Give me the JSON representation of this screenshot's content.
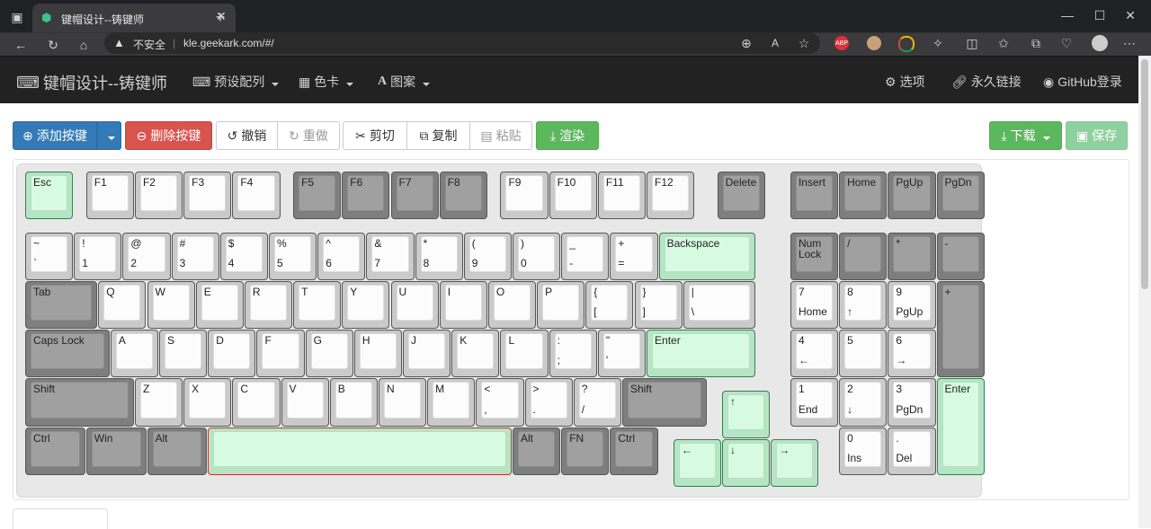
{
  "browser": {
    "tab_title": "键帽设计--铸键师",
    "security_label": "不安全",
    "url": "kle.geekark.com/#/"
  },
  "navbar": {
    "brand": "键帽设计--铸键师",
    "menus": [
      "预设配列",
      "色卡",
      "图案"
    ],
    "right": [
      "选项",
      "永久链接",
      "GitHub登录"
    ]
  },
  "toolbar": {
    "add_key": "添加按键",
    "delete_key": "删除按键",
    "undo": "撤销",
    "redo": "重做",
    "cut": "剪切",
    "copy": "复制",
    "paste": "粘贴",
    "render": "渲染",
    "download": "下载",
    "save": "保存"
  },
  "colors": {
    "key_white": "#fcfcfc",
    "key_gray": "#a0a0a0",
    "key_green": "#d6fbe1",
    "brand_primary": "#337ab7",
    "danger": "#d9534f",
    "success": "#5cb85c"
  },
  "keys": [
    {
      "top": "Esc",
      "c": "green"
    },
    {
      "top": "F1",
      "c": "white"
    },
    {
      "top": "F2",
      "c": "white"
    },
    {
      "top": "F3",
      "c": "white"
    },
    {
      "top": "F4",
      "c": "white"
    },
    {
      "top": "F5",
      "c": "gray"
    },
    {
      "top": "F6",
      "c": "gray"
    },
    {
      "top": "F7",
      "c": "gray"
    },
    {
      "top": "F8",
      "c": "gray"
    },
    {
      "top": "F9",
      "c": "white"
    },
    {
      "top": "F10",
      "c": "white"
    },
    {
      "top": "F11",
      "c": "white"
    },
    {
      "top": "F12",
      "c": "white"
    },
    {
      "top": "Delete",
      "c": "gray"
    },
    {
      "top": "Insert",
      "c": "gray"
    },
    {
      "top": "Home",
      "c": "gray"
    },
    {
      "top": "PgUp",
      "c": "gray"
    },
    {
      "top": "PgDn",
      "c": "gray"
    },
    {
      "top": "~",
      "bot": "`",
      "c": "white"
    },
    {
      "top": "!",
      "bot": "1",
      "c": "white"
    },
    {
      "top": "@",
      "bot": "2",
      "c": "white"
    },
    {
      "top": "#",
      "bot": "3",
      "c": "white"
    },
    {
      "top": "$",
      "bot": "4",
      "c": "white"
    },
    {
      "top": "%",
      "bot": "5",
      "c": "white"
    },
    {
      "top": "^",
      "bot": "6",
      "c": "white"
    },
    {
      "top": "&",
      "bot": "7",
      "c": "white"
    },
    {
      "top": "*",
      "bot": "8",
      "c": "white"
    },
    {
      "top": "(",
      "bot": "9",
      "c": "white"
    },
    {
      "top": ")",
      "bot": "0",
      "c": "white"
    },
    {
      "top": "_",
      "bot": "-",
      "c": "white"
    },
    {
      "top": "+",
      "bot": "=",
      "c": "white"
    },
    {
      "top": "Backspace",
      "c": "green"
    },
    {
      "top": "Num\nLock",
      "c": "gray"
    },
    {
      "top": "/",
      "c": "gray"
    },
    {
      "top": "*",
      "c": "gray"
    },
    {
      "top": "-",
      "c": "gray"
    },
    {
      "top": "Tab",
      "c": "gray"
    },
    {
      "top": "Q",
      "c": "white"
    },
    {
      "top": "W",
      "c": "white"
    },
    {
      "top": "E",
      "c": "white"
    },
    {
      "top": "R",
      "c": "white"
    },
    {
      "top": "T",
      "c": "white"
    },
    {
      "top": "Y",
      "c": "white"
    },
    {
      "top": "U",
      "c": "white"
    },
    {
      "top": "I",
      "c": "white"
    },
    {
      "top": "O",
      "c": "white"
    },
    {
      "top": "P",
      "c": "white"
    },
    {
      "top": "{",
      "bot": "[",
      "c": "white"
    },
    {
      "top": "}",
      "bot": "]",
      "c": "white"
    },
    {
      "top": "|",
      "bot": "\\",
      "c": "white"
    },
    {
      "top": "7",
      "bot": "Home",
      "c": "white"
    },
    {
      "top": "8",
      "bot": "↑",
      "c": "white"
    },
    {
      "top": "9",
      "bot": "PgUp",
      "c": "white"
    },
    {
      "top": "+",
      "c": "gray"
    },
    {
      "top": "Caps Lock",
      "c": "gray"
    },
    {
      "top": "A",
      "c": "white"
    },
    {
      "top": "S",
      "c": "white"
    },
    {
      "top": "D",
      "c": "white"
    },
    {
      "top": "F",
      "c": "white"
    },
    {
      "top": "G",
      "c": "white"
    },
    {
      "top": "H",
      "c": "white"
    },
    {
      "top": "J",
      "c": "white"
    },
    {
      "top": "K",
      "c": "white"
    },
    {
      "top": "L",
      "c": "white"
    },
    {
      "top": ":",
      "bot": ";",
      "c": "white"
    },
    {
      "top": "\"",
      "bot": "'",
      "c": "white"
    },
    {
      "top": "Enter",
      "c": "green"
    },
    {
      "top": "4",
      "bot": "←",
      "c": "white"
    },
    {
      "top": "5",
      "c": "white"
    },
    {
      "top": "6",
      "bot": "→",
      "c": "white"
    },
    {
      "top": "Shift",
      "c": "gray"
    },
    {
      "top": "Z",
      "c": "white"
    },
    {
      "top": "X",
      "c": "white"
    },
    {
      "top": "C",
      "c": "white"
    },
    {
      "top": "V",
      "c": "white"
    },
    {
      "top": "B",
      "c": "white"
    },
    {
      "top": "N",
      "c": "white"
    },
    {
      "top": "M",
      "c": "white"
    },
    {
      "top": "<",
      "bot": ",",
      "c": "white"
    },
    {
      "top": ">",
      "bot": ".",
      "c": "white"
    },
    {
      "top": "?",
      "bot": "/",
      "c": "white"
    },
    {
      "top": "Shift",
      "c": "gray"
    },
    {
      "top": "↑",
      "c": "green"
    },
    {
      "top": "1",
      "bot": "End",
      "c": "white"
    },
    {
      "top": "2",
      "bot": "↓",
      "c": "white"
    },
    {
      "top": "3",
      "bot": "PgDn",
      "c": "white"
    },
    {
      "top": "Enter",
      "c": "green"
    },
    {
      "top": "Ctrl",
      "c": "gray"
    },
    {
      "top": "Win",
      "c": "gray"
    },
    {
      "top": "Alt",
      "c": "gray"
    },
    {
      "top": "",
      "c": "green",
      "space": true
    },
    {
      "top": "Alt",
      "c": "gray"
    },
    {
      "top": "FN",
      "c": "gray"
    },
    {
      "top": "Ctrl",
      "c": "gray"
    },
    {
      "top": "←",
      "c": "green"
    },
    {
      "top": "↓",
      "c": "green"
    },
    {
      "top": "→",
      "c": "green"
    },
    {
      "top": "0",
      "bot": "Ins",
      "c": "white"
    },
    {
      "top": ".",
      "bot": "Del",
      "c": "white"
    }
  ]
}
